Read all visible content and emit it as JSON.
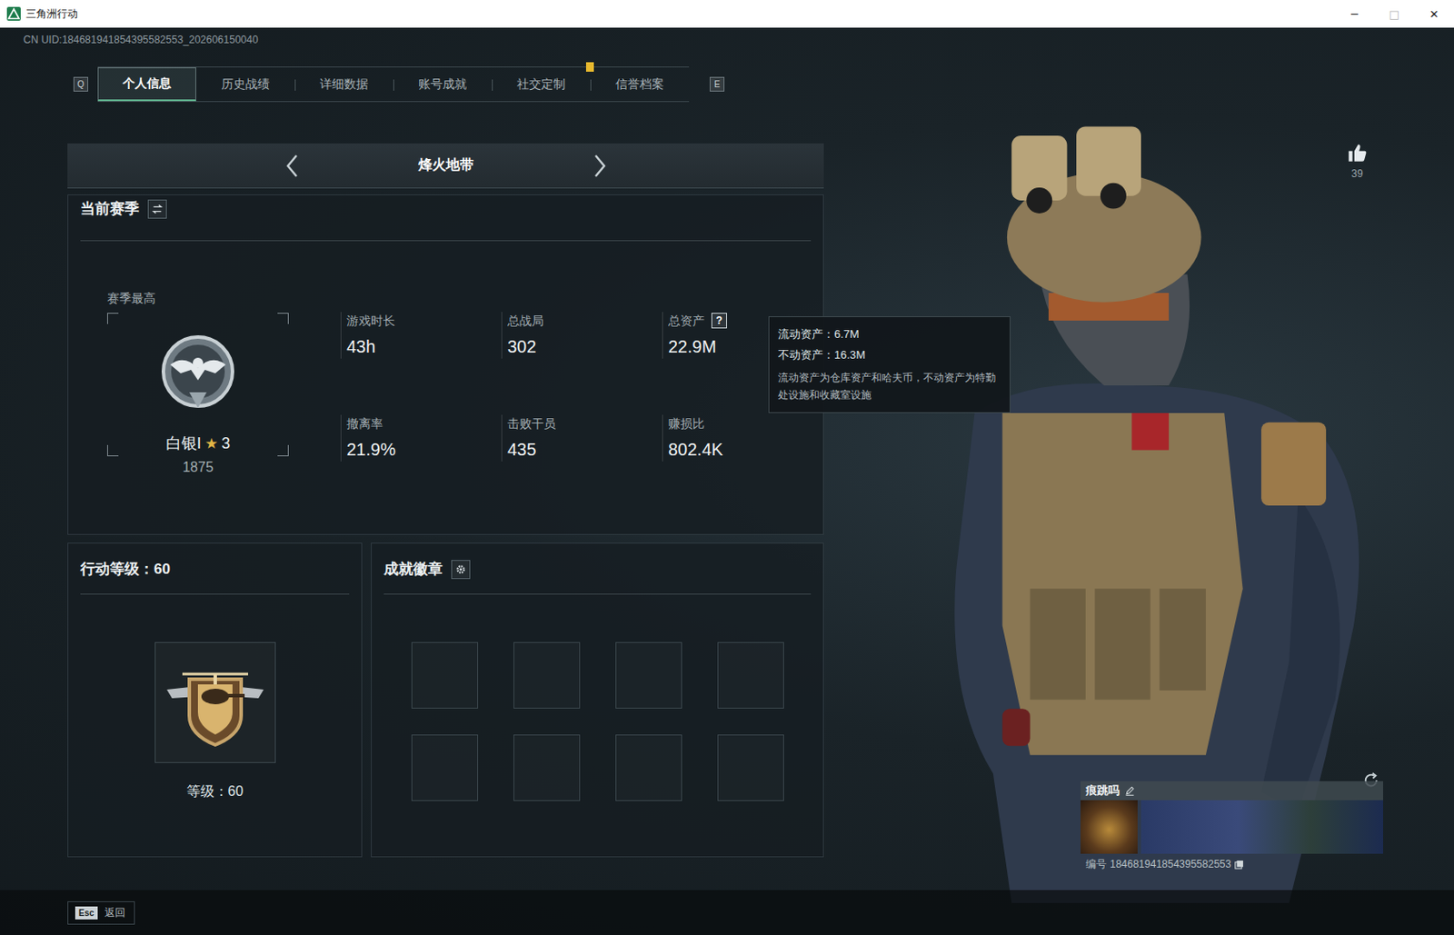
{
  "window": {
    "title": "三角洲行动",
    "controls": [
      {
        "glyph": "─",
        "disabled": false
      },
      {
        "glyph": "□",
        "disabled": true
      },
      {
        "glyph": "✕",
        "disabled": false
      }
    ]
  },
  "uid": "CN UID:184681941854395582553_202606150040",
  "tabs": {
    "prev_key": "Q",
    "next_key": "E",
    "items": [
      {
        "label": "个人信息",
        "selected": true,
        "notice": false
      },
      {
        "label": "历史战绩",
        "selected": false,
        "notice": false
      },
      {
        "label": "详细数据",
        "selected": false,
        "notice": false
      },
      {
        "label": "账号成就",
        "selected": false,
        "notice": false
      },
      {
        "label": "社交定制",
        "selected": false,
        "notice": true
      },
      {
        "label": "信誉档案",
        "selected": false,
        "notice": false
      }
    ]
  },
  "mode": {
    "title": "烽火地带"
  },
  "season": {
    "title": "当前赛季",
    "best_label": "赛季最高",
    "help_glyph": "?",
    "rank": {
      "name": "白银I",
      "star_glyph": "★",
      "stars_text": "3",
      "score": "1875"
    },
    "stats": [
      {
        "label": "游戏时长",
        "value": "43h",
        "help": false
      },
      {
        "label": "总战局",
        "value": "302",
        "help": false
      },
      {
        "label": "总资产",
        "value": "22.9M",
        "help": true
      },
      {
        "label": "撤离率",
        "value": "21.9%",
        "help": false
      },
      {
        "label": "击败干员",
        "value": "435",
        "help": false
      },
      {
        "label": "赚损比",
        "value": "802.4K",
        "help": false
      }
    ]
  },
  "tooltip": {
    "lines": [
      "流动资产：6.7M",
      "不动资产：16.3M"
    ],
    "note": "流动资产为仓库资产和哈夫币，不动资产为特勤处设施和收藏室设施"
  },
  "level": {
    "title": "行动等级：60",
    "caption": "等级：60"
  },
  "badges": {
    "title": "成就徽章",
    "slots": [
      {
        "filled": false
      },
      {
        "filled": false
      },
      {
        "filled": false
      },
      {
        "filled": false
      },
      {
        "filled": false
      },
      {
        "filled": false
      },
      {
        "filled": false
      },
      {
        "filled": false
      }
    ]
  },
  "like": {
    "count": "39"
  },
  "player": {
    "name": "痕跳吗",
    "id_label": "编号",
    "id": "184681941854395582553"
  },
  "footer": {
    "key": "Esc",
    "label": "返回"
  }
}
